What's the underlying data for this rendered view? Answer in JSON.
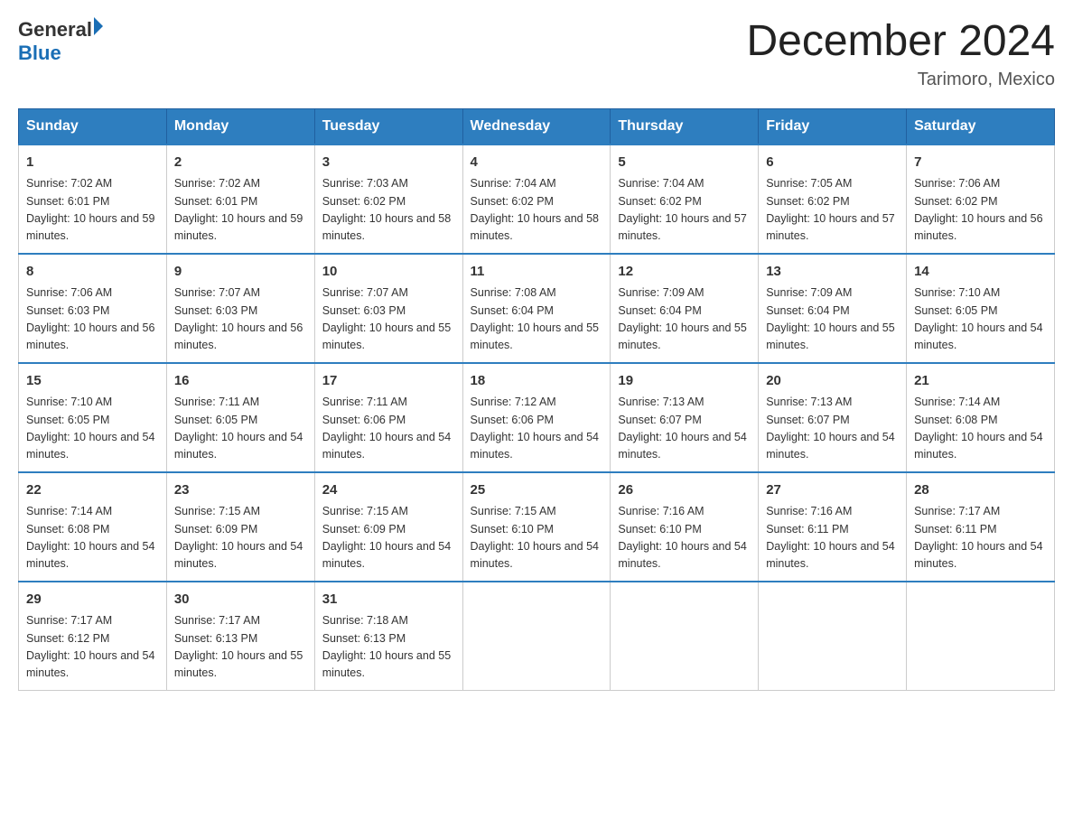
{
  "header": {
    "logo_general": "General",
    "logo_blue": "Blue",
    "month_title": "December 2024",
    "location": "Tarimoro, Mexico"
  },
  "days_of_week": [
    "Sunday",
    "Monday",
    "Tuesday",
    "Wednesday",
    "Thursday",
    "Friday",
    "Saturday"
  ],
  "weeks": [
    [
      {
        "day": "1",
        "sunrise": "7:02 AM",
        "sunset": "6:01 PM",
        "daylight": "10 hours and 59 minutes."
      },
      {
        "day": "2",
        "sunrise": "7:02 AM",
        "sunset": "6:01 PM",
        "daylight": "10 hours and 59 minutes."
      },
      {
        "day": "3",
        "sunrise": "7:03 AM",
        "sunset": "6:02 PM",
        "daylight": "10 hours and 58 minutes."
      },
      {
        "day": "4",
        "sunrise": "7:04 AM",
        "sunset": "6:02 PM",
        "daylight": "10 hours and 58 minutes."
      },
      {
        "day": "5",
        "sunrise": "7:04 AM",
        "sunset": "6:02 PM",
        "daylight": "10 hours and 57 minutes."
      },
      {
        "day": "6",
        "sunrise": "7:05 AM",
        "sunset": "6:02 PM",
        "daylight": "10 hours and 57 minutes."
      },
      {
        "day": "7",
        "sunrise": "7:06 AM",
        "sunset": "6:02 PM",
        "daylight": "10 hours and 56 minutes."
      }
    ],
    [
      {
        "day": "8",
        "sunrise": "7:06 AM",
        "sunset": "6:03 PM",
        "daylight": "10 hours and 56 minutes."
      },
      {
        "day": "9",
        "sunrise": "7:07 AM",
        "sunset": "6:03 PM",
        "daylight": "10 hours and 56 minutes."
      },
      {
        "day": "10",
        "sunrise": "7:07 AM",
        "sunset": "6:03 PM",
        "daylight": "10 hours and 55 minutes."
      },
      {
        "day": "11",
        "sunrise": "7:08 AM",
        "sunset": "6:04 PM",
        "daylight": "10 hours and 55 minutes."
      },
      {
        "day": "12",
        "sunrise": "7:09 AM",
        "sunset": "6:04 PM",
        "daylight": "10 hours and 55 minutes."
      },
      {
        "day": "13",
        "sunrise": "7:09 AM",
        "sunset": "6:04 PM",
        "daylight": "10 hours and 55 minutes."
      },
      {
        "day": "14",
        "sunrise": "7:10 AM",
        "sunset": "6:05 PM",
        "daylight": "10 hours and 54 minutes."
      }
    ],
    [
      {
        "day": "15",
        "sunrise": "7:10 AM",
        "sunset": "6:05 PM",
        "daylight": "10 hours and 54 minutes."
      },
      {
        "day": "16",
        "sunrise": "7:11 AM",
        "sunset": "6:05 PM",
        "daylight": "10 hours and 54 minutes."
      },
      {
        "day": "17",
        "sunrise": "7:11 AM",
        "sunset": "6:06 PM",
        "daylight": "10 hours and 54 minutes."
      },
      {
        "day": "18",
        "sunrise": "7:12 AM",
        "sunset": "6:06 PM",
        "daylight": "10 hours and 54 minutes."
      },
      {
        "day": "19",
        "sunrise": "7:13 AM",
        "sunset": "6:07 PM",
        "daylight": "10 hours and 54 minutes."
      },
      {
        "day": "20",
        "sunrise": "7:13 AM",
        "sunset": "6:07 PM",
        "daylight": "10 hours and 54 minutes."
      },
      {
        "day": "21",
        "sunrise": "7:14 AM",
        "sunset": "6:08 PM",
        "daylight": "10 hours and 54 minutes."
      }
    ],
    [
      {
        "day": "22",
        "sunrise": "7:14 AM",
        "sunset": "6:08 PM",
        "daylight": "10 hours and 54 minutes."
      },
      {
        "day": "23",
        "sunrise": "7:15 AM",
        "sunset": "6:09 PM",
        "daylight": "10 hours and 54 minutes."
      },
      {
        "day": "24",
        "sunrise": "7:15 AM",
        "sunset": "6:09 PM",
        "daylight": "10 hours and 54 minutes."
      },
      {
        "day": "25",
        "sunrise": "7:15 AM",
        "sunset": "6:10 PM",
        "daylight": "10 hours and 54 minutes."
      },
      {
        "day": "26",
        "sunrise": "7:16 AM",
        "sunset": "6:10 PM",
        "daylight": "10 hours and 54 minutes."
      },
      {
        "day": "27",
        "sunrise": "7:16 AM",
        "sunset": "6:11 PM",
        "daylight": "10 hours and 54 minutes."
      },
      {
        "day": "28",
        "sunrise": "7:17 AM",
        "sunset": "6:11 PM",
        "daylight": "10 hours and 54 minutes."
      }
    ],
    [
      {
        "day": "29",
        "sunrise": "7:17 AM",
        "sunset": "6:12 PM",
        "daylight": "10 hours and 54 minutes."
      },
      {
        "day": "30",
        "sunrise": "7:17 AM",
        "sunset": "6:13 PM",
        "daylight": "10 hours and 55 minutes."
      },
      {
        "day": "31",
        "sunrise": "7:18 AM",
        "sunset": "6:13 PM",
        "daylight": "10 hours and 55 minutes."
      },
      null,
      null,
      null,
      null
    ]
  ],
  "labels": {
    "sunrise": "Sunrise: ",
    "sunset": "Sunset: ",
    "daylight": "Daylight: "
  }
}
